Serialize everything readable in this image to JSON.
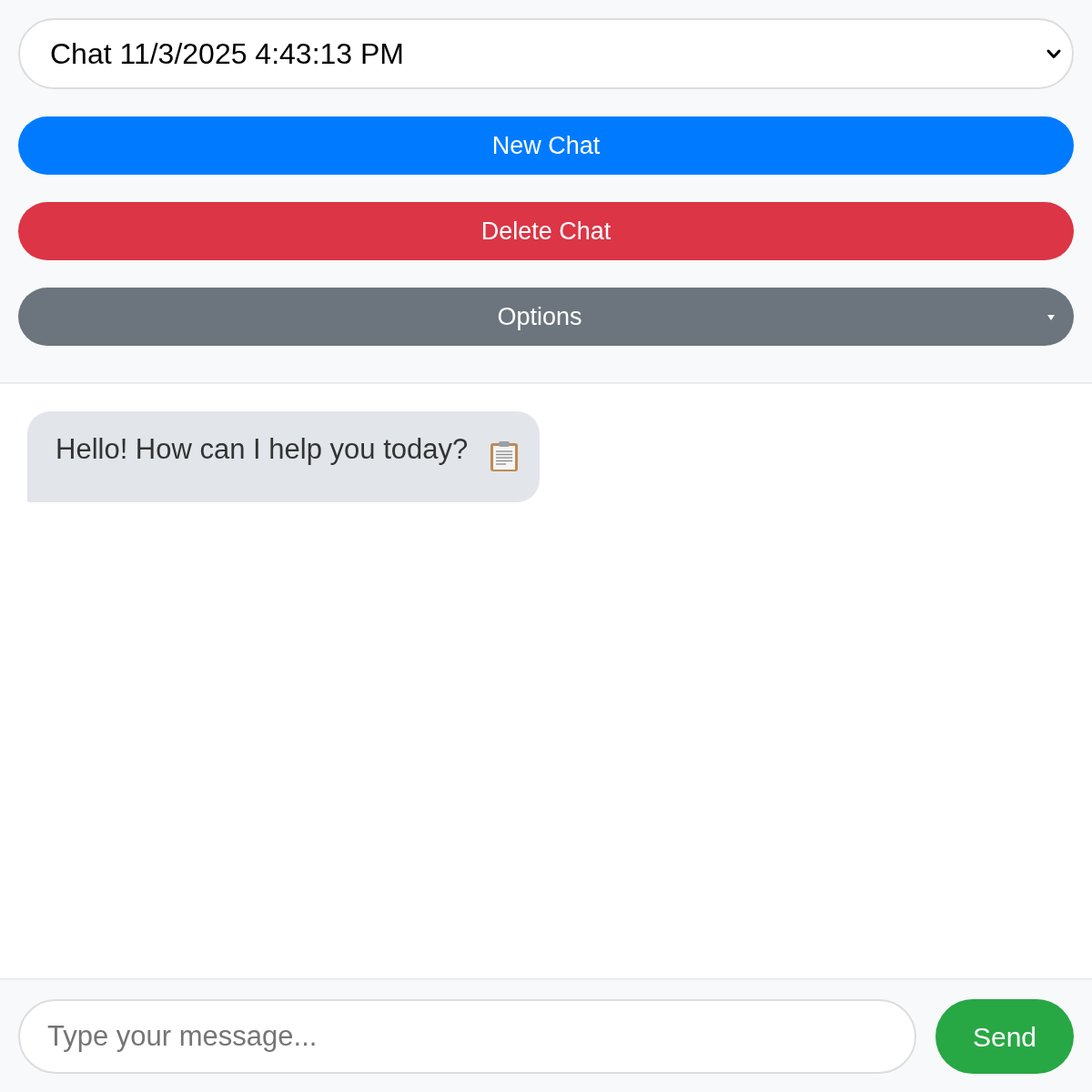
{
  "chat_select": {
    "value": "Chat 11/3/2025 4:43:13 PM"
  },
  "buttons": [
    {
      "label": "New Chat",
      "kind": "primary"
    },
    {
      "label": "Delete Chat",
      "kind": "danger"
    },
    {
      "label": "Options",
      "kind": "dropdown"
    }
  ],
  "messages": [
    {
      "kind": "assistant",
      "text": "Hello! How can I help you today?"
    }
  ],
  "composer": {
    "placeholder": "Type your message...",
    "send_label": "Send"
  }
}
